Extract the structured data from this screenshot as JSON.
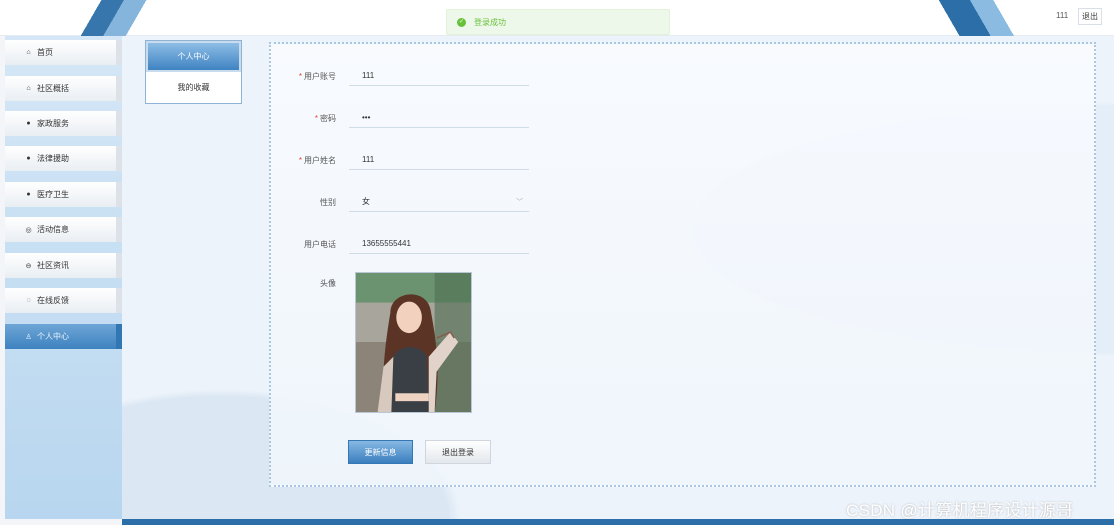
{
  "header": {
    "toast": "登录成功",
    "username": "111",
    "logout_label": "退出"
  },
  "sidebar": {
    "items": [
      {
        "label": "首页",
        "icon": "home-icon",
        "glyph": "⌂"
      },
      {
        "label": "社区概括",
        "icon": "house-icon",
        "glyph": "⌂"
      },
      {
        "label": "家政服务",
        "icon": "info-dot-icon",
        "glyph": "●"
      },
      {
        "label": "法律援助",
        "icon": "help-dot-icon",
        "glyph": "●"
      },
      {
        "label": "医疗卫生",
        "icon": "info-dot-icon",
        "glyph": "●"
      },
      {
        "label": "活动信息",
        "icon": "circle-icon",
        "glyph": "◎"
      },
      {
        "label": "社区资讯",
        "icon": "circle-icon",
        "glyph": "⊖"
      },
      {
        "label": "在线反馈",
        "icon": "feedback-icon",
        "glyph": "◌"
      },
      {
        "label": "个人中心",
        "icon": "user-icon",
        "glyph": "♙",
        "active": true
      }
    ]
  },
  "subtabs": [
    {
      "label": "个人中心",
      "active": true
    },
    {
      "label": "我的收藏",
      "active": false
    }
  ],
  "form": {
    "account": {
      "label": "用户账号",
      "value": "111",
      "required": true
    },
    "password": {
      "label": "密码",
      "value": "•••",
      "required": true
    },
    "name": {
      "label": "用户姓名",
      "value": "111",
      "required": true
    },
    "gender": {
      "label": "性别",
      "value": "女",
      "required": false
    },
    "phone": {
      "label": "用户电话",
      "value": "13655555441",
      "required": false
    },
    "avatar_label": "头像"
  },
  "buttons": {
    "update": "更新信息",
    "logout": "退出登录"
  },
  "watermark": "CSDN @计算机程序设计源哥",
  "colors": {
    "accent": "#3b7fbf",
    "toast_text": "#67c23a",
    "required": "#e0483a"
  }
}
